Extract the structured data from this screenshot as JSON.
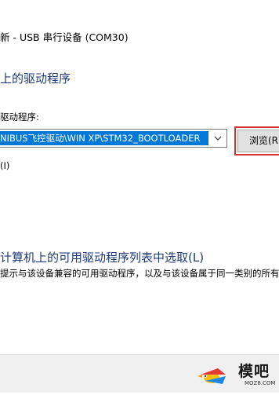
{
  "window": {
    "title": "新 - USB 串行设备 (COM30)"
  },
  "page": {
    "heading": "上的驱动程序"
  },
  "path_field": {
    "label": "驱动程序:",
    "value": "NIBUS飞控驱动\\WIN XP\\STM32_BOOTLOADER",
    "browse_label": "浏览(R)"
  },
  "subfolders": {
    "label": "(I)"
  },
  "pick_option": {
    "title": "计算机上的可用驱动程序列表中选取(L)",
    "description": "提示与该设备兼容的可用驱动程序，以及与该设备属于同一类别的所有"
  },
  "watermark": {
    "text": "模吧",
    "subtext": "MOZ8.COM"
  },
  "colors": {
    "accent_link": "#1e3a78",
    "selection": "#0078d7",
    "highlight_box": "#d32f2f"
  }
}
